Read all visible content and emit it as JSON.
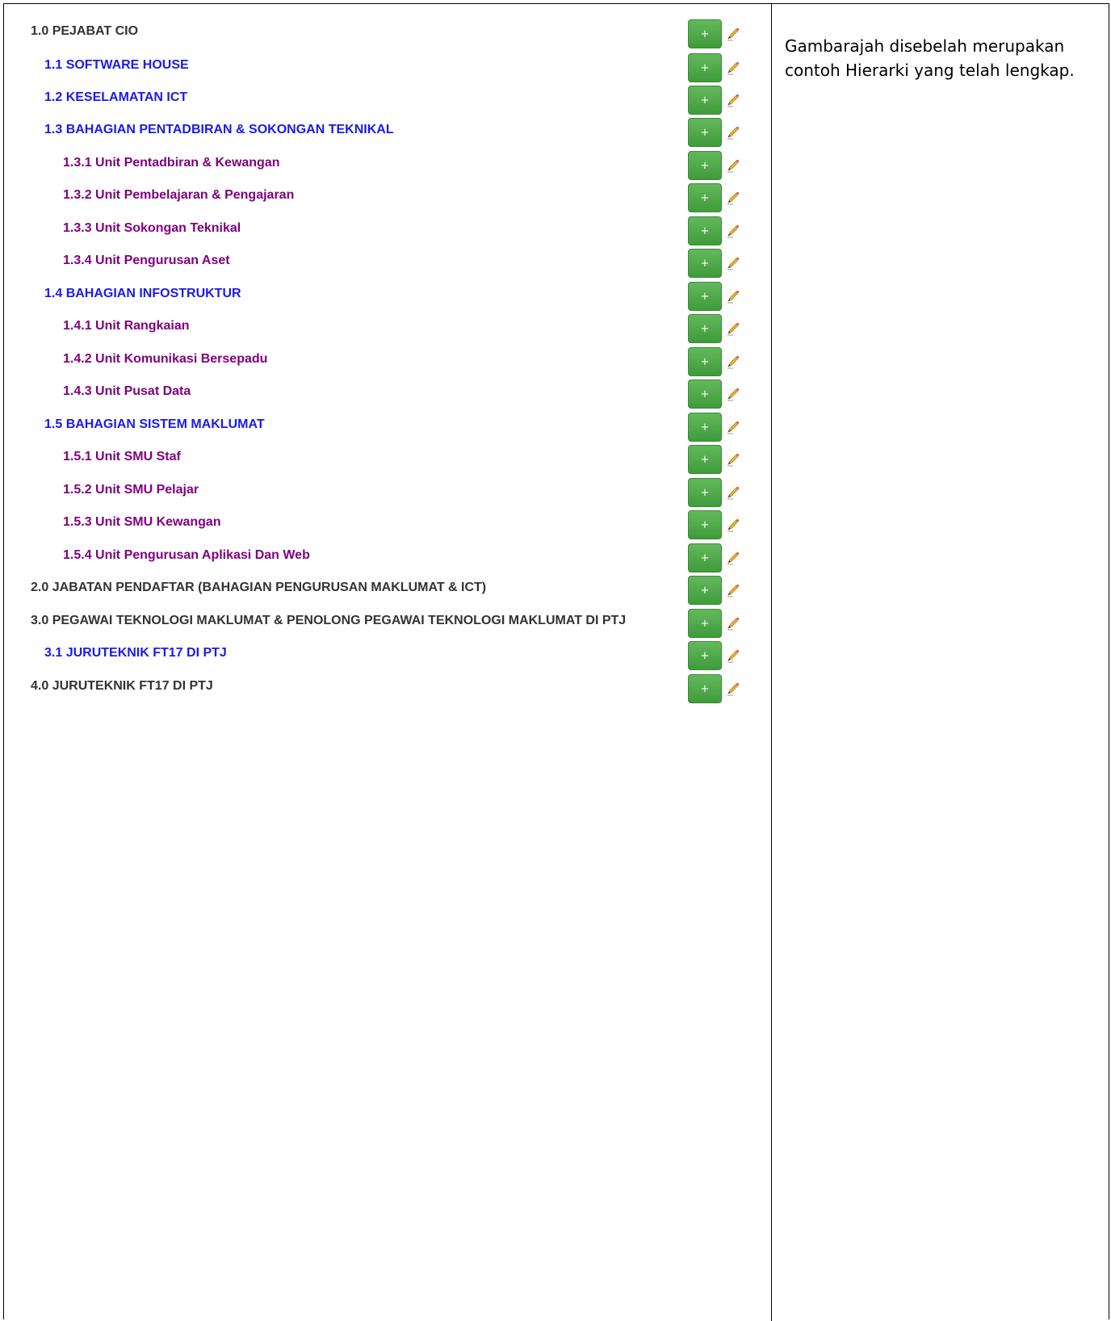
{
  "hierarchy": [
    {
      "level": 0,
      "label": "1.0 PEJABAT CIO"
    },
    {
      "level": 1,
      "label": "1.1 SOFTWARE HOUSE"
    },
    {
      "level": 1,
      "label": "1.2 KESELAMATAN ICT"
    },
    {
      "level": 1,
      "label": "1.3 BAHAGIAN PENTADBIRAN & SOKONGAN TEKNIKAL"
    },
    {
      "level": 2,
      "label": "1.3.1 Unit Pentadbiran & Kewangan"
    },
    {
      "level": 2,
      "label": "1.3.2 Unit Pembelajaran & Pengajaran"
    },
    {
      "level": 2,
      "label": "1.3.3 Unit Sokongan Teknikal"
    },
    {
      "level": 2,
      "label": "1.3.4 Unit Pengurusan Aset"
    },
    {
      "level": 1,
      "label": "1.4 BAHAGIAN INFOSTRUKTUR"
    },
    {
      "level": 2,
      "label": "1.4.1 Unit Rangkaian"
    },
    {
      "level": 2,
      "label": "1.4.2 Unit Komunikasi Bersepadu"
    },
    {
      "level": 2,
      "label": "1.4.3 Unit Pusat Data"
    },
    {
      "level": 1,
      "label": "1.5 BAHAGIAN SISTEM MAKLUMAT"
    },
    {
      "level": 2,
      "label": "1.5.1 Unit SMU Staf"
    },
    {
      "level": 2,
      "label": "1.5.2 Unit SMU Pelajar"
    },
    {
      "level": 2,
      "label": "1.5.3 Unit SMU Kewangan"
    },
    {
      "level": 2,
      "label": "1.5.4 Unit Pengurusan Aplikasi Dan Web"
    },
    {
      "level": 0,
      "label": "2.0 JABATAN PENDAFTAR (BAHAGIAN PENGURUSAN MAKLUMAT & ICT)"
    },
    {
      "level": 0,
      "label": "3.0 PEGAWAI TEKNOLOGI MAKLUMAT & PENOLONG PEGAWAI TEKNOLOGI MAKLUMAT DI PTJ"
    },
    {
      "level": 1,
      "label": "3.1 JURUTEKNIK FT17 DI PTJ"
    },
    {
      "level": 0,
      "label": "4.0 JURUTEKNIK FT17 DI PTJ"
    }
  ],
  "actions": {
    "add_label": "+",
    "add_icon": "plus-icon",
    "edit_icon": "pencil-icon"
  },
  "colors": {
    "level0_text": "#333333",
    "level1_text": "#1a1aee",
    "level2_text": "#800080",
    "add_button": "#4caf50"
  },
  "note": "Gambarajah disebelah merupakan contoh Hierarki yang telah lengkap."
}
